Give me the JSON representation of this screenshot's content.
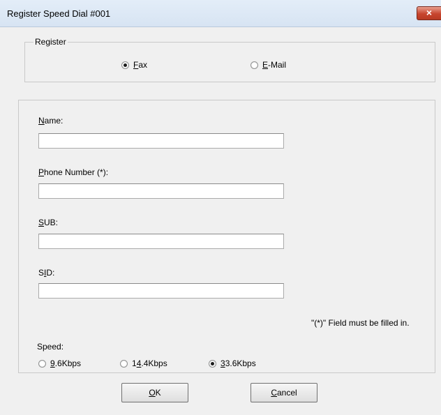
{
  "window": {
    "title": "Register Speed Dial #001",
    "close_label": "×"
  },
  "register": {
    "legend": "Register",
    "options": [
      {
        "label": "Fax",
        "selected": true
      },
      {
        "label": "E-Mail",
        "selected": false
      }
    ]
  },
  "fields": [
    {
      "label": "Name:",
      "value": ""
    },
    {
      "label": "Phone Number (*):",
      "value": ""
    },
    {
      "label": "SUB:",
      "value": ""
    },
    {
      "label": "SID:",
      "value": ""
    }
  ],
  "note": "\"(*)\" Field must be filled in.",
  "speed": {
    "label": "Speed:",
    "options": [
      {
        "label": "9.6Kbps",
        "selected": false
      },
      {
        "label": "14.4Kbps",
        "selected": false
      },
      {
        "label": "33.6Kbps",
        "selected": true
      }
    ]
  },
  "buttons": {
    "ok": "OK",
    "cancel": "Cancel"
  }
}
